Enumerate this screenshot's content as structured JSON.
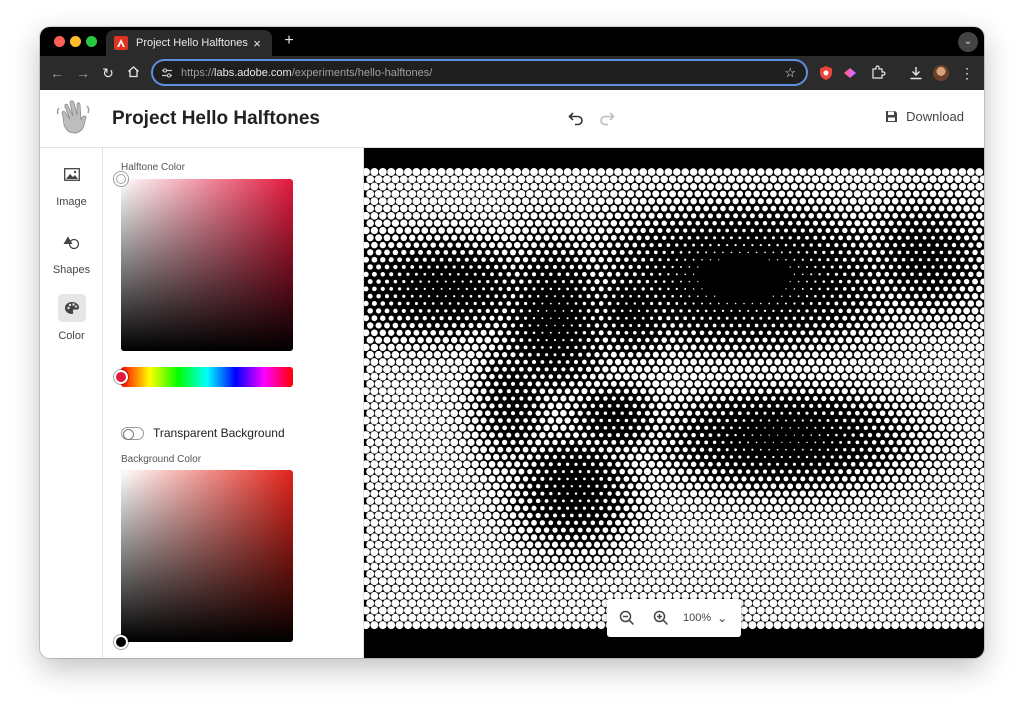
{
  "browser": {
    "tab_title": "Project Hello Halftones",
    "tab_close": "×",
    "new_tab": "+",
    "tab_menu": "⌄",
    "url_scheme": "https://",
    "url_host": "labs.adobe.com",
    "url_path": "/experiments/hello-halftones/",
    "bookmark_icon": "star-icon"
  },
  "app": {
    "title": "Project Hello Halftones",
    "download_label": "Download"
  },
  "rail": {
    "items": [
      {
        "label": "Image",
        "icon": "image-icon"
      },
      {
        "label": "Shapes",
        "icon": "shapes-icon"
      },
      {
        "label": "Color",
        "icon": "palette-icon",
        "active": true
      }
    ]
  },
  "panel": {
    "halftone_color_label": "Halftone Color",
    "halftone_hue_color": "#e3183d",
    "transparent_background_label": "Transparent Background",
    "transparent_background_on": false,
    "background_color_label": "Background Color",
    "background_hue_color": "#e3231a"
  },
  "zoom": {
    "level": "100%"
  },
  "colors": {
    "halftone_dots": "#ffffff",
    "background": "#000000",
    "omnibox_focus": "#5f8fe0"
  }
}
